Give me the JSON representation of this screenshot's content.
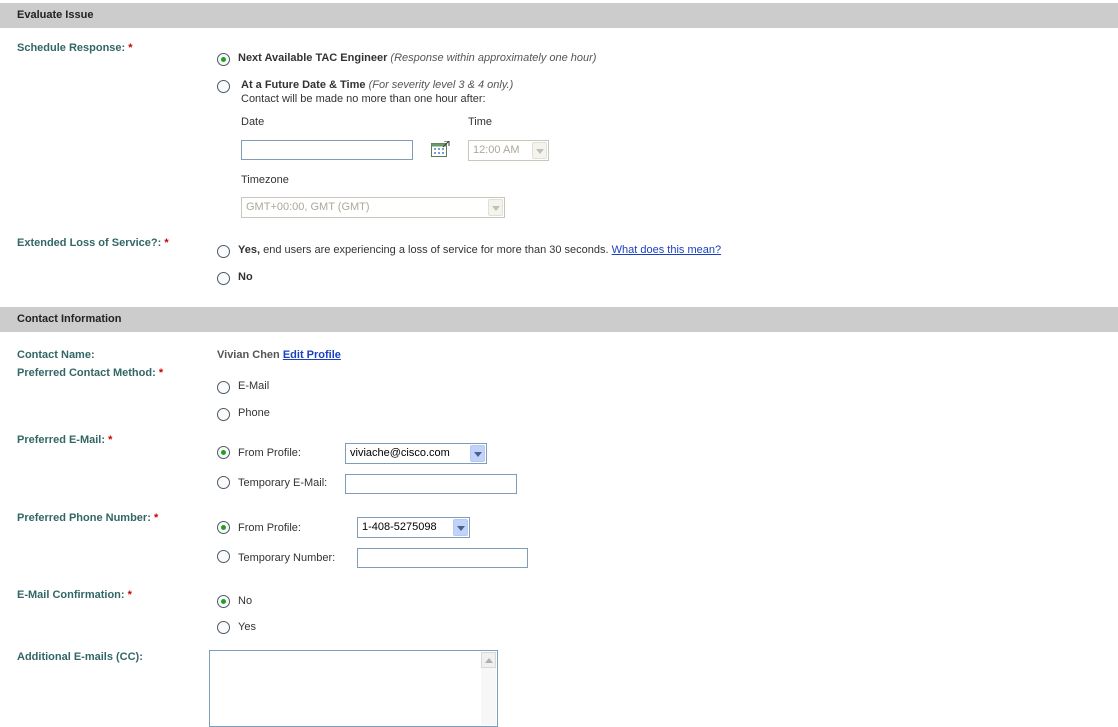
{
  "evaluate_section": {
    "title": "Evaluate Issue",
    "schedule_label": "Schedule Response:",
    "schedule_options": [
      {
        "label": "Next Available TAC Engineer",
        "hint": "(Response within approximately one hour)",
        "checked": true
      },
      {
        "label": "At a Future Date & Time",
        "hint": "(For severity level 3 & 4 only.)",
        "sub": "Contact will be made no more than one hour after:",
        "checked": false
      }
    ],
    "date_label": "Date",
    "date_value": "",
    "time_label": "Time",
    "time_value": "12:00 AM",
    "timezone_label": "Timezone",
    "timezone_value": "GMT+00:00, GMT (GMT)",
    "extended_label": "Extended Loss of Service?:",
    "extended_yes_bold": "Yes,",
    "extended_yes_text": "end users are experiencing a loss of service for more than 30 seconds.",
    "extended_link": "What does this mean?",
    "extended_no": "No"
  },
  "contact_section": {
    "title": "Contact Information",
    "name_label": "Contact Name:",
    "name_value": "Vivian Chen",
    "edit_profile": "Edit Profile",
    "method_label": "Preferred Contact Method:",
    "method_options": [
      "E-Mail",
      "Phone"
    ],
    "email_label": "Preferred E-Mail:",
    "email_from_profile": "From Profile:",
    "email_selected": "viviache@cisco.com",
    "email_temporary": "Temporary E-Mail:",
    "email_temporary_value": "",
    "phone_label": "Preferred Phone Number:",
    "phone_from_profile": "From Profile:",
    "phone_selected": "1-408-5275098",
    "phone_temporary": "Temporary Number:",
    "phone_temporary_value": "",
    "confirm_label": "E-Mail Confirmation:",
    "confirm_options": [
      "No",
      "Yes"
    ],
    "cc_label": "Additional E-mails (CC):",
    "cc_value": ""
  },
  "required_marker": "*",
  "colors": {
    "section_bar": "#cccccc",
    "label": "#336666",
    "required": "#cc0000",
    "radio_checked": "#21a121",
    "link": "#1a3fbf"
  }
}
